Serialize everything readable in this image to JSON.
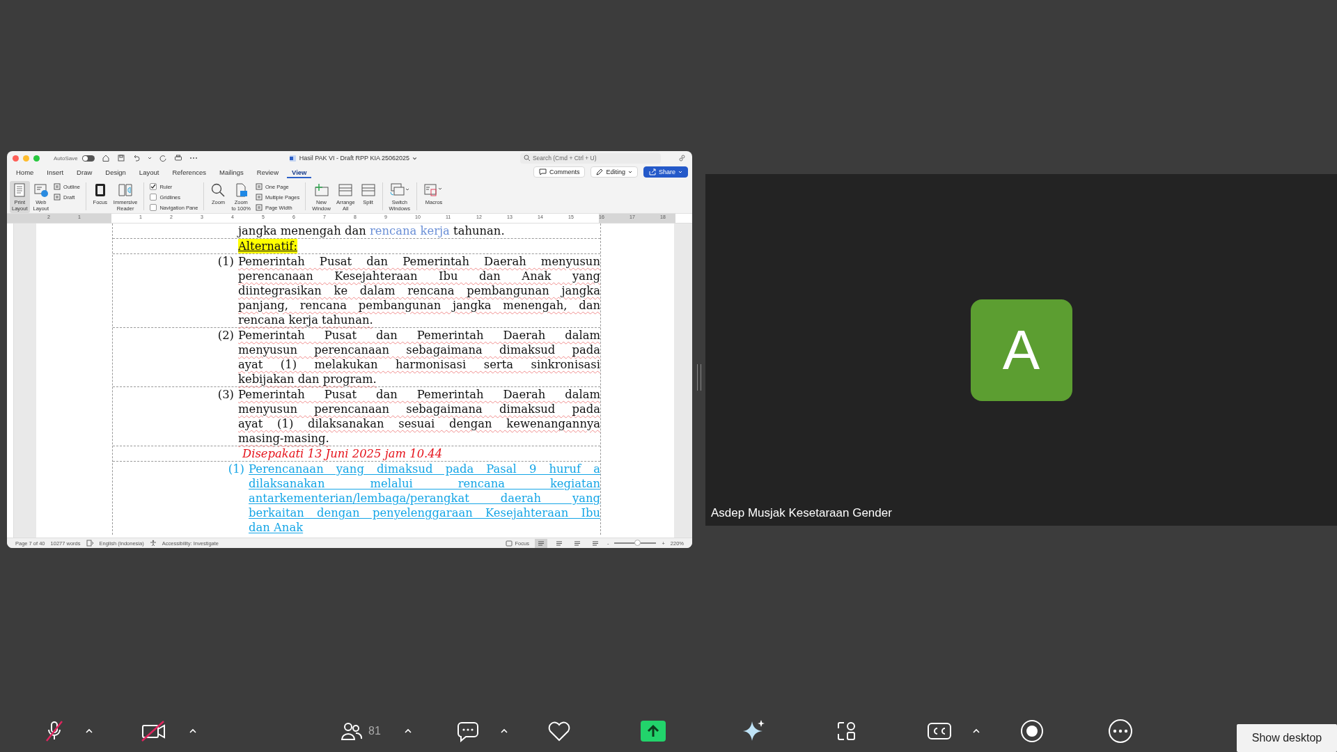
{
  "word": {
    "title": "Hasil PAK VI - Draft RPP KIA 25062025",
    "autosave": {
      "label": "AutoSave",
      "on": false
    },
    "search": {
      "placeholder": "Search (Cmd + Ctrl + U)"
    },
    "tabs": [
      {
        "label": "Home",
        "selected": false
      },
      {
        "label": "Insert",
        "selected": false
      },
      {
        "label": "Draw",
        "selected": false
      },
      {
        "label": "Design",
        "selected": false
      },
      {
        "label": "Layout",
        "selected": false
      },
      {
        "label": "References",
        "selected": false
      },
      {
        "label": "Mailings",
        "selected": false
      },
      {
        "label": "Review",
        "selected": false
      },
      {
        "label": "View",
        "selected": true
      }
    ],
    "actions": [
      {
        "label": "Comments",
        "kind": "comments"
      },
      {
        "label": "Editing",
        "kind": "editing"
      },
      {
        "label": "Share",
        "kind": "share"
      }
    ],
    "ribbon": [
      {
        "items": [
          {
            "kind": "big",
            "lines": [
              "Print",
              "Layout"
            ],
            "selected": true
          },
          {
            "kind": "big",
            "lines": [
              "Web",
              "Layout"
            ],
            "selected": false
          },
          {
            "kind": "small",
            "label": "Outline",
            "selected": false
          },
          {
            "kind": "small",
            "label": "Draft",
            "selected": false
          }
        ]
      },
      {
        "items": [
          {
            "kind": "big",
            "lines": [
              "Focus"
            ]
          },
          {
            "kind": "big",
            "lines": [
              "Immersive",
              "Reader"
            ]
          }
        ]
      },
      {
        "items": [
          {
            "kind": "check",
            "label": "Ruler",
            "checked": true
          },
          {
            "kind": "check",
            "label": "Gridlines",
            "checked": false
          },
          {
            "kind": "check",
            "label": "Navigation Pane",
            "checked": false
          }
        ]
      },
      {
        "items": [
          {
            "kind": "big",
            "lines": [
              "Zoom"
            ]
          },
          {
            "kind": "big",
            "lines": [
              "Zoom",
              "to 100%"
            ]
          },
          {
            "kind": "small",
            "label": "One Page"
          },
          {
            "kind": "small",
            "label": "Multiple Pages"
          },
          {
            "kind": "small",
            "label": "Page Width"
          }
        ]
      },
      {
        "items": [
          {
            "kind": "big",
            "lines": [
              "New",
              "Window"
            ]
          },
          {
            "kind": "big",
            "lines": [
              "Arrange",
              "All"
            ]
          },
          {
            "kind": "big",
            "lines": [
              "Split"
            ]
          }
        ]
      },
      {
        "items": [
          {
            "kind": "big",
            "lines": [
              "Switch",
              "Windows"
            ]
          }
        ]
      },
      {
        "items": [
          {
            "kind": "big",
            "lines": [
              "Macros"
            ]
          }
        ]
      }
    ],
    "ruler": [
      "2",
      "1",
      "1",
      "2",
      "3",
      "4",
      "5",
      "6",
      "7",
      "8",
      "9",
      "10",
      "11",
      "12",
      "13",
      "14",
      "15",
      "16",
      "17",
      "18"
    ],
    "rows": [
      {
        "kind": "plain",
        "segments": [
          {
            "text": "jangka menengah dan ",
            "kind": "normal"
          },
          {
            "text": "rencana kerja",
            "kind": "inserted"
          },
          {
            "text": " tahunan.",
            "kind": "normal"
          }
        ]
      },
      {
        "kind": "heading",
        "text": "Alternatif:"
      },
      {
        "kind": "numbered",
        "number": "(1)",
        "lines": [
          "Pemerintah Pusat dan Pemerintah Daerah menyusun",
          "perencanaan Kesejahteraan Ibu dan Anak yang",
          "diintegrasikan ke dalam rencana pembangunan jangka",
          "panjang, rencana pembangunan jangka menengah, dan",
          "rencana kerja tahunan."
        ]
      },
      {
        "kind": "numbered",
        "number": "(2)",
        "lines": [
          "Pemerintah Pusat dan Pemerintah Daerah dalam",
          "menyusun perencanaan sebagaimana dimaksud pada",
          "ayat (1) melakukan harmonisasi serta sinkronisasi",
          "kebijakan dan program."
        ]
      },
      {
        "kind": "numbered",
        "number": "(3)",
        "lines": [
          "Pemerintah Pusat dan Pemerintah Daerah dalam",
          "menyusun perencanaan sebagaimana dimaksud pada",
          "ayat (1) dilaksanakan sesuai dengan kewenangannya",
          "masing-masing."
        ]
      },
      {
        "kind": "note",
        "text": "Disepakati 13 Juni 2025 jam 10.44"
      },
      {
        "kind": "inserted",
        "number": "(1)",
        "lines": [
          "Perencanaan yang dimaksud pada Pasal 9 huruf a",
          "dilaksanakan melalui rencana kegiatan",
          "antarkementerian/lembaga/perangkat daerah yang",
          "berkaitan dengan penyelenggaraan Kesejahteraan Ibu",
          "dan Anak"
        ]
      }
    ],
    "status": {
      "page": "Page 7 of 40",
      "words": "10277 words",
      "language": "English (Indonesia)",
      "accessibility": "Accessibility: Investigate",
      "focus": "Focus",
      "views": [
        {
          "selected": true
        },
        {
          "selected": false
        },
        {
          "selected": false
        },
        {
          "selected": false
        }
      ],
      "zoom_out": "-",
      "zoom_in": "+",
      "zoom": {
        "level": 0.55,
        "reading": "220%"
      }
    }
  },
  "tile": {
    "initial": "A",
    "name": "Asdep Musjak Kesetaraan Gender"
  },
  "toolbar": {
    "mic_muted": true,
    "video_off": true,
    "participants": "81",
    "tooltip": "Show desktop"
  }
}
